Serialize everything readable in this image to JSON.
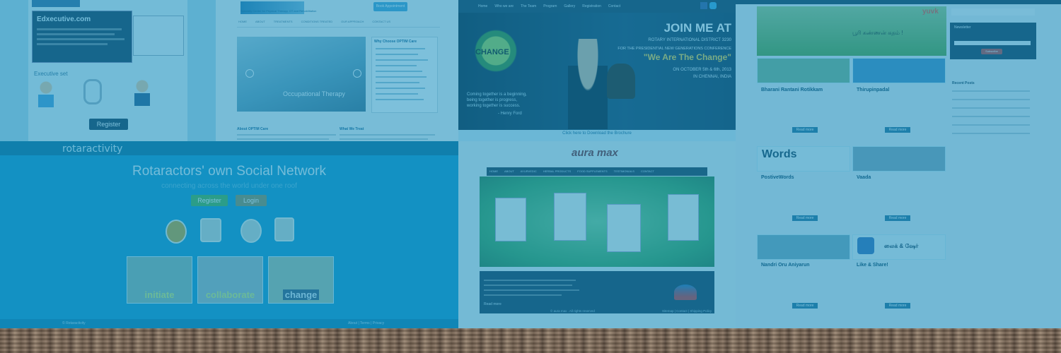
{
  "panel_top_left": {
    "site_name": "Edxecutive.com",
    "register_label": "Register",
    "caption": "Executive set"
  },
  "rotaractivity": {
    "brand": "rotaractivity",
    "heading": "Rotaractors' own Social Network",
    "subheading": "connecting across the world under one roof",
    "register_label": "Register",
    "login_label": "Login",
    "thumbs": [
      "initiate",
      "collaborate",
      "change"
    ],
    "footer_left": "© Rotaractivity",
    "footer_right": "About | Terms | Privacy"
  },
  "optim": {
    "tagline": "Specialty Center for Physical Therapy, OT and Rehabilitation",
    "cta": "Book Appointment",
    "nav": [
      "HOME",
      "ABOUT",
      "TREATMENTS",
      "CONDITIONS TREATED",
      "OUR APPROACH",
      "CONTACT US"
    ],
    "slide_caption": "Occupational Therapy",
    "why_title": "Why Choose OPTIM Care",
    "about_title": "About OPTIM Care",
    "what_title": "What We Treat"
  },
  "rotary_event": {
    "nav": [
      "Home",
      "Who we are",
      "The Team",
      "Program",
      "Gallery",
      "Registration",
      "Contact"
    ],
    "headline": "JOIN ME AT",
    "line1": "ROTARY INTERNATIONAL DISTRICT 3230",
    "line2": "FOR THE PRESIDENTIAL NEW GENERATIONS CONFERENCE",
    "quote": "\"We Are The Change\"",
    "dates": "ON OCTOBER 5th & 6th, 2013",
    "place": "IN CHENNAI, INDIA",
    "logo_text": "CHANGE",
    "quote_small_1": "Coming together is a beginning,",
    "quote_small_2": "being together is progress,",
    "quote_small_3": "working together is success.",
    "quote_author": "- Henry Ford",
    "download": "Click here to Download the Brochure"
  },
  "auramax": {
    "brand": "aura max",
    "nav": [
      "HOME",
      "ABOUT",
      "AYURVEDIC",
      "HERBAL PRODUCTS",
      "FOOD SUPPLEMENTS",
      "TESTIMONIALS",
      "CONTACT"
    ],
    "read_more": "Read more",
    "copyright": "© aura max . All rights reserved",
    "footer_links": "Sitemap | Contact | Shipping Policy"
  },
  "tamil_blog": {
    "brand": "yuvk",
    "banner_text": "பூரி கண்ணன் கதம் !",
    "posts": [
      {
        "title": "Bharani Rantani Rotikkam",
        "read": "Read more"
      },
      {
        "title": "Thirupinpadal",
        "read": "Read more"
      },
      {
        "title": "Words",
        "read": "Read more"
      },
      {
        "title": "PostiveWords",
        "read": "Read more"
      },
      {
        "title": "Vaada",
        "read": "Read more"
      },
      {
        "title": "Nandri Oru Aniyarun",
        "read": "Read more"
      },
      {
        "title": "Like & Share!",
        "read": "Read more"
      }
    ],
    "side_newsletter": "Newsletter",
    "side_subscribe": "Subscribe",
    "side_recent": "Recent Posts",
    "like_tamil": "லைக் & ஷேர்"
  },
  "colors": {
    "overlay": "#128cbe",
    "rotaract_bg": "#1597c9",
    "register_green": "#49b14a",
    "login_olive": "#8a8d5a",
    "dark_panel": "#1c3950"
  }
}
